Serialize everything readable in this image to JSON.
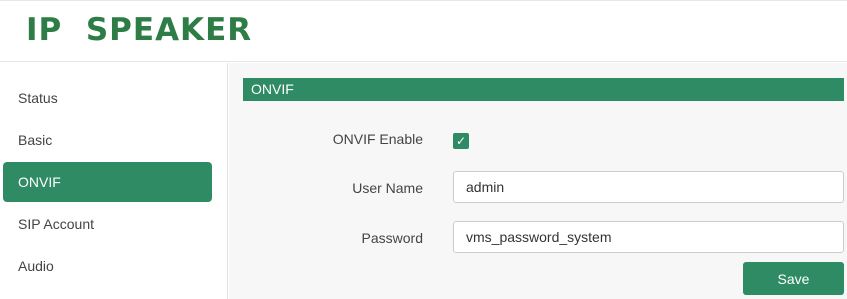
{
  "header": {
    "logo_text": "IP  SPEAKER"
  },
  "sidebar": {
    "items": [
      {
        "label": "Status"
      },
      {
        "label": "Basic"
      },
      {
        "label": "ONVIF",
        "active": true
      },
      {
        "label": "SIP Account"
      },
      {
        "label": "Audio"
      }
    ]
  },
  "main": {
    "section_title": "ONVIF",
    "onvif_enable": {
      "label": "ONVIF Enable",
      "checked": true,
      "check_glyph": "✓"
    },
    "user_name": {
      "label": "User Name",
      "value": "admin"
    },
    "password": {
      "label": "Password",
      "value": "vms_password_system"
    },
    "save_label": "Save"
  },
  "colors": {
    "brand": "#2e7d46",
    "accent": "#2e8b63"
  }
}
